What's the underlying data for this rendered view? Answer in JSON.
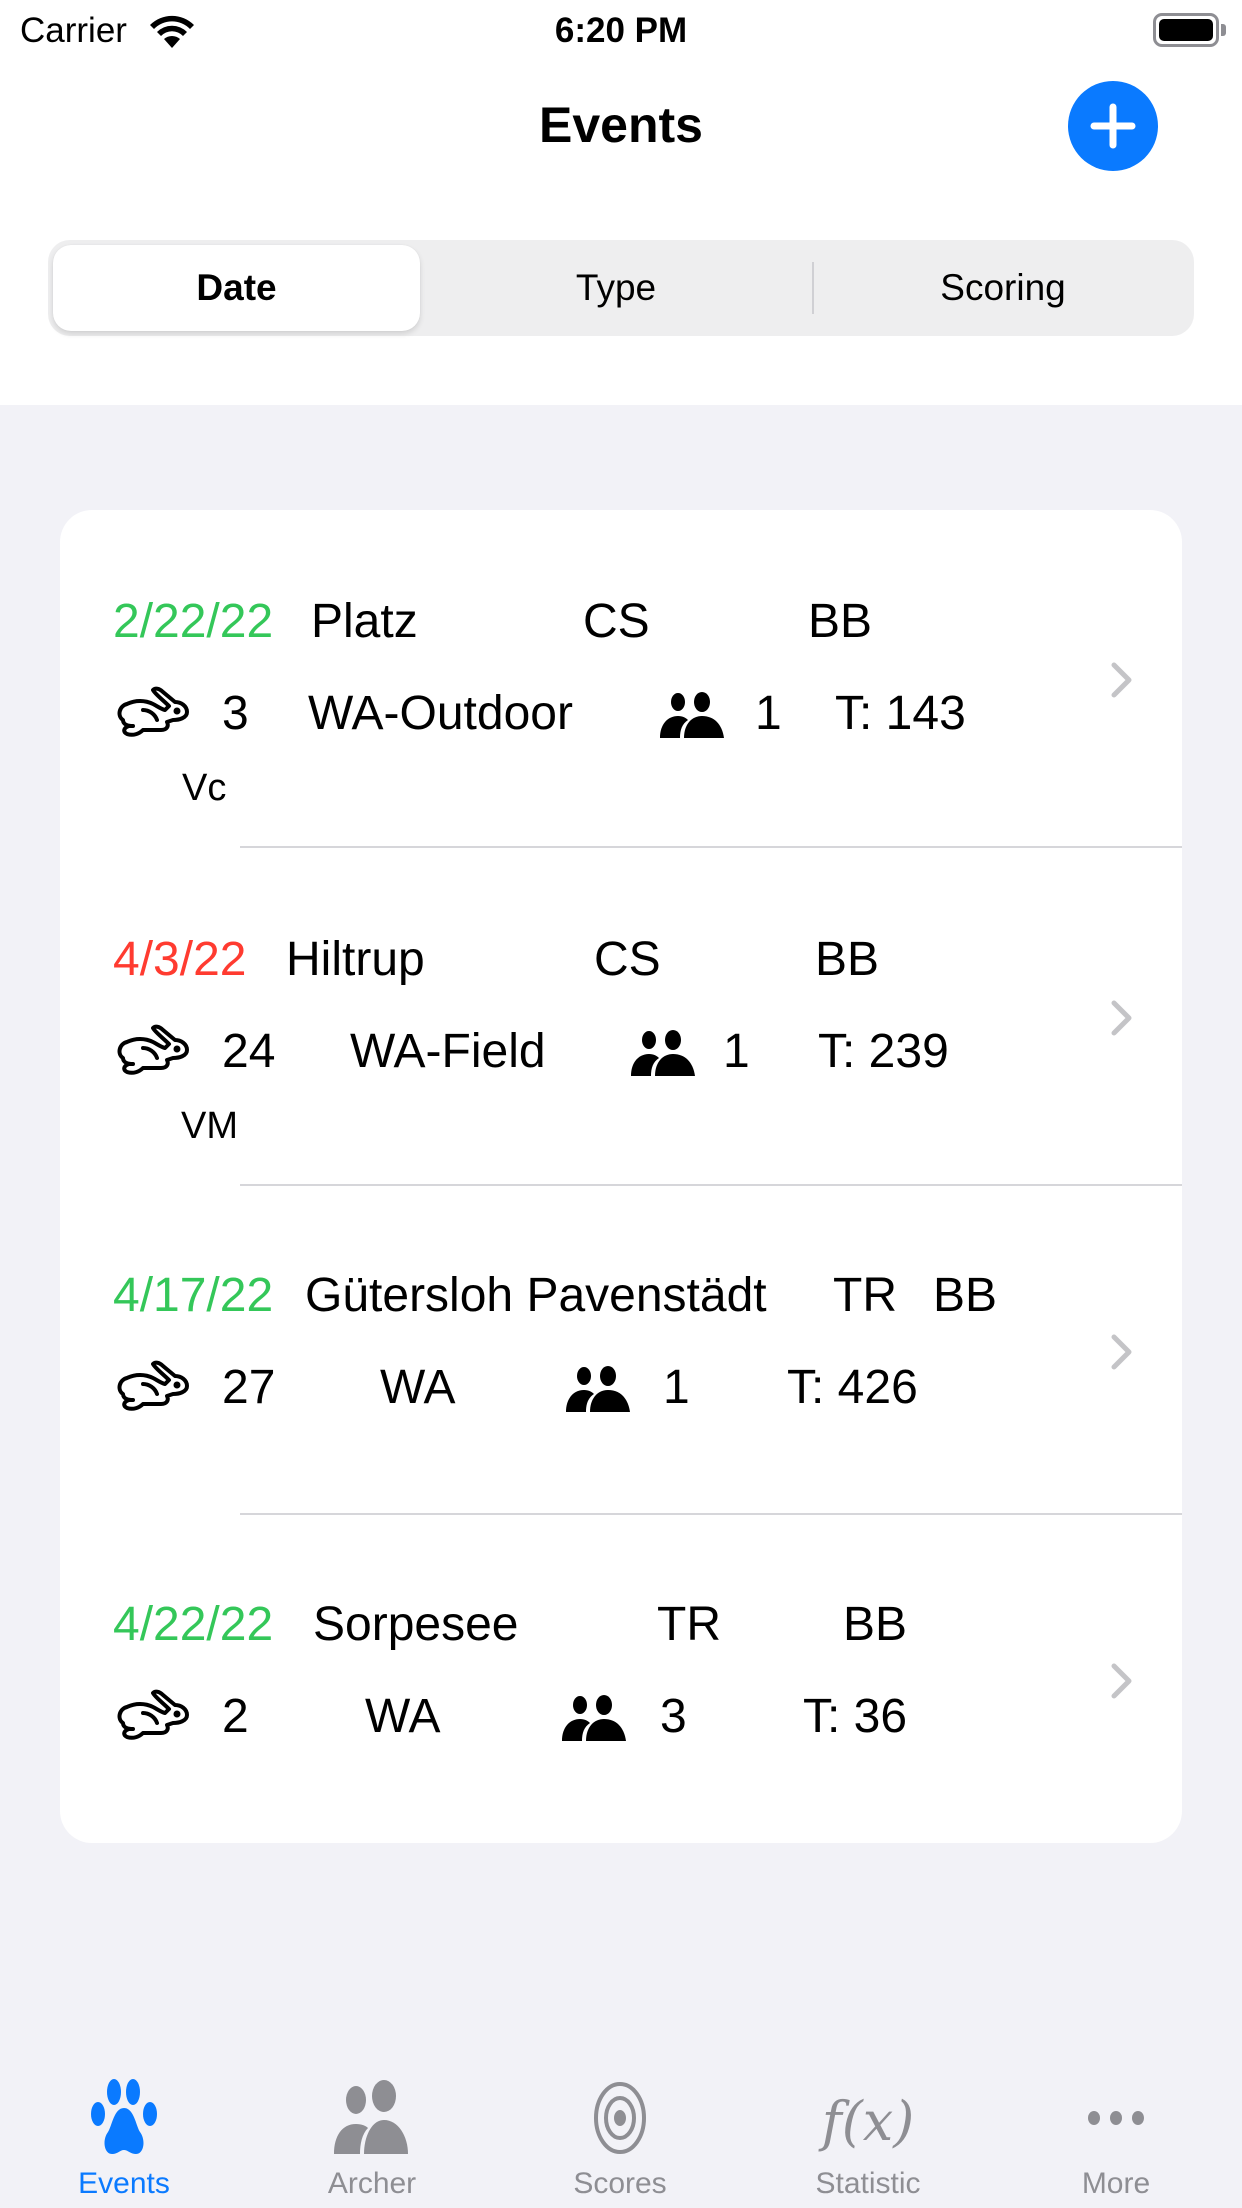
{
  "status_bar": {
    "carrier": "Carrier",
    "time": "6:20 PM",
    "wifi_icon": "wifi-icon",
    "battery_icon": "battery-full-icon"
  },
  "nav": {
    "title": "Events",
    "add_button_icon": "plus-circle-icon",
    "add_color": "#0a7aff"
  },
  "segments": {
    "selected": "Date",
    "items": [
      {
        "label": "Date"
      },
      {
        "label": "Type"
      },
      {
        "label": "Scoring"
      }
    ]
  },
  "colors": {
    "date_future": "#34c759",
    "date_past": "#ff3b30",
    "background": "#f2f2f7",
    "chevron": "#c4c4c7"
  },
  "events": [
    {
      "date": "2/22/22",
      "date_status": "green",
      "location": "Platz",
      "scoring": "CS",
      "bow": "BB",
      "targets": "3",
      "type": "WA-Outdoor",
      "archers": "1",
      "total": "T: 143",
      "note": "Vc"
    },
    {
      "date": "4/3/22",
      "date_status": "red",
      "location": "Hiltrup",
      "scoring": "CS",
      "bow": "BB",
      "targets": "24",
      "type": "WA-Field",
      "archers": "1",
      "total": "T: 239",
      "note": "VM"
    },
    {
      "date": "4/17/22",
      "date_status": "green",
      "location": "Gütersloh Pavenstädt",
      "scoring": "TR",
      "bow": "BB",
      "targets": "27",
      "type": "WA",
      "archers": "1",
      "total": "T: 426",
      "note": ""
    },
    {
      "date": "4/22/22",
      "date_status": "green",
      "location": "Sorpesee",
      "scoring": "TR",
      "bow": "BB",
      "targets": "2",
      "type": "WA",
      "archers": "3",
      "total": "T: 36",
      "note": ""
    }
  ],
  "tabbar": {
    "active": "Events",
    "items": [
      {
        "label": "Events",
        "icon": "paw-icon"
      },
      {
        "label": "Archer",
        "icon": "people-icon"
      },
      {
        "label": "Scores",
        "icon": "target-icon"
      },
      {
        "label": "Statistic",
        "icon": "function-icon"
      },
      {
        "label": "More",
        "icon": "ellipsis-icon"
      }
    ]
  }
}
